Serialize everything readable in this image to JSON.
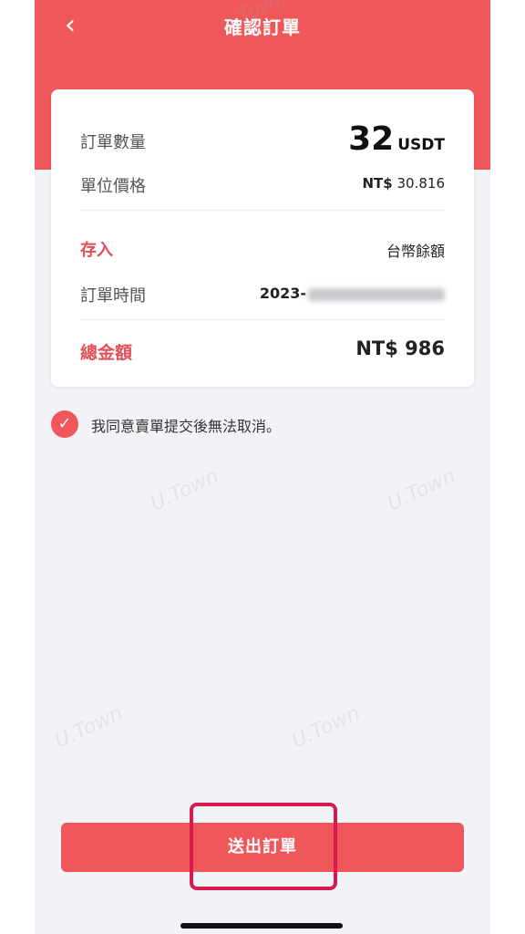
{
  "header": {
    "title": "確認訂單",
    "back_icon": "chevron-left-icon"
  },
  "order": {
    "qty_label": "訂單數量",
    "qty_value": "32",
    "qty_unit": "USDT",
    "price_label": "單位價格",
    "price_currency": "NT$",
    "price_value": "30.816",
    "deposit_label": "存入",
    "deposit_value": "台幣餘額",
    "time_label": "訂單時間",
    "time_value": "2023-",
    "total_label": "總金額",
    "total_value": "NT$ 986"
  },
  "agreement": {
    "checked": true,
    "text": "我同意賣單提交後無法取消。"
  },
  "submit": {
    "label": "送出訂單"
  },
  "watermark": "U.Town",
  "colors": {
    "accent": "#f0575a",
    "highlight": "#d81b4f"
  }
}
